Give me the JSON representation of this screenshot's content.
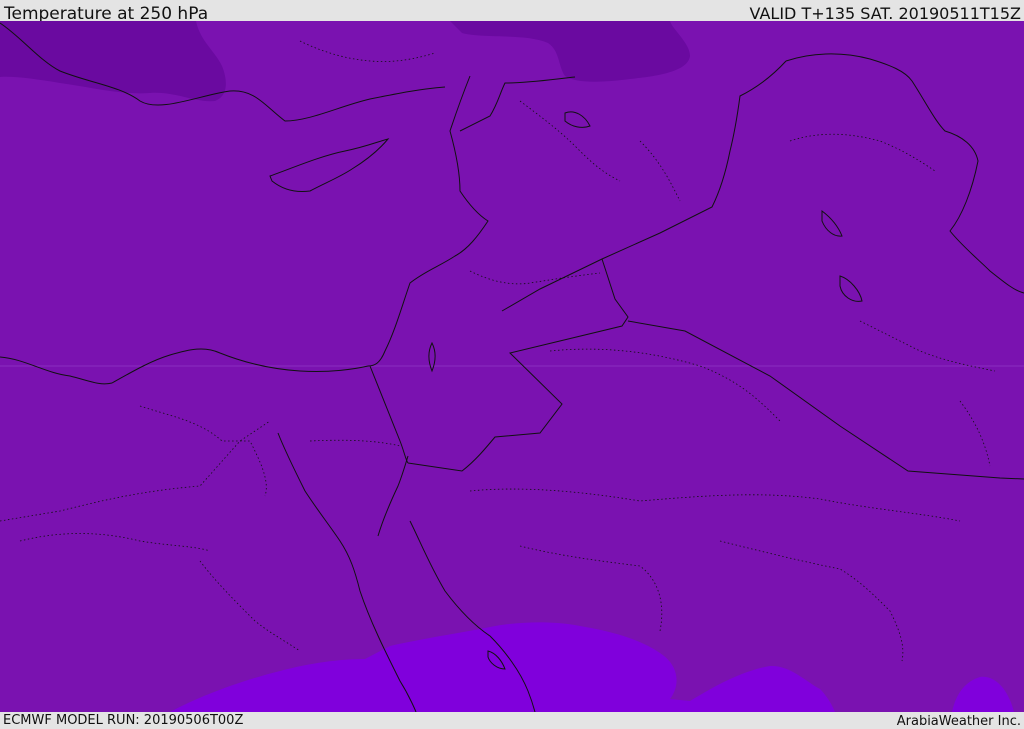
{
  "header": {
    "title": "Temperature at 250 hPa",
    "valid_time": "VALID T+135 SAT. 20190511T15Z"
  },
  "footer": {
    "model_run": "ECMWF MODEL RUN: 20190506T00Z",
    "credit": "ArabiaWeather Inc."
  },
  "map": {
    "variable": "Temperature",
    "level": "250 hPa",
    "colors": {
      "base_fill": "#7a12b0",
      "cold_fill": "#6a0aa0",
      "warm_fill": "#8000dc",
      "border_line": "#111111",
      "grid_line": "#9a4ad0"
    }
  }
}
